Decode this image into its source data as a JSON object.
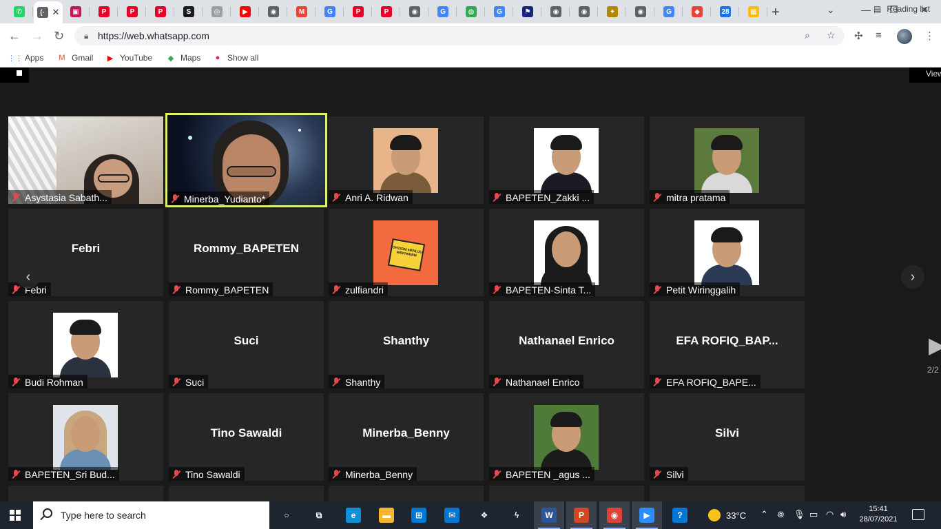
{
  "browser": {
    "tabs": [
      {
        "name": "whatsapp",
        "glyph": "✆",
        "color": "#25d366"
      },
      {
        "name": "active",
        "glyph": "(·",
        "color": "#5f6368"
      },
      {
        "name": "profile",
        "glyph": "▣",
        "color": "#c2185b"
      },
      {
        "name": "pinterest-1",
        "glyph": "P",
        "color": "#e60023"
      },
      {
        "name": "pinterest-2",
        "glyph": "P",
        "color": "#e60023"
      },
      {
        "name": "pinterest-3",
        "glyph": "P",
        "color": "#e60023"
      },
      {
        "name": "scribd",
        "glyph": "S",
        "color": "#1b1b1b"
      },
      {
        "name": "generic-1",
        "glyph": "◎",
        "color": "#9aa0a6"
      },
      {
        "name": "youtube",
        "glyph": "▶",
        "color": "#ff0000"
      },
      {
        "name": "chrome-1",
        "glyph": "◉",
        "color": "#5f6368"
      },
      {
        "name": "gmail",
        "glyph": "M",
        "color": "#ea4335"
      },
      {
        "name": "google-1",
        "glyph": "G",
        "color": "#4285f4"
      },
      {
        "name": "pinterest-4",
        "glyph": "P",
        "color": "#e60023"
      },
      {
        "name": "pinterest-5",
        "glyph": "P",
        "color": "#e60023"
      },
      {
        "name": "chrome-2",
        "glyph": "◉",
        "color": "#5f6368"
      },
      {
        "name": "google-2",
        "glyph": "G",
        "color": "#4285f4"
      },
      {
        "name": "lens",
        "glyph": "◍",
        "color": "#34a853"
      },
      {
        "name": "google-3",
        "glyph": "G",
        "color": "#4285f4"
      },
      {
        "name": "flag",
        "glyph": "⚑",
        "color": "#1a237e"
      },
      {
        "name": "globe-1",
        "glyph": "◉",
        "color": "#5f6368"
      },
      {
        "name": "chrome-3",
        "glyph": "◉",
        "color": "#5f6368"
      },
      {
        "name": "emblem",
        "glyph": "✦",
        "color": "#b28704"
      },
      {
        "name": "globe-2",
        "glyph": "◉",
        "color": "#5f6368"
      },
      {
        "name": "google-4",
        "glyph": "G",
        "color": "#4285f4"
      },
      {
        "name": "maps",
        "glyph": "◆",
        "color": "#ea4335"
      },
      {
        "name": "calendar",
        "glyph": "28",
        "color": "#1a73e8"
      },
      {
        "name": "tiles",
        "glyph": "▦",
        "color": "#fbbc04"
      }
    ],
    "url": "https://web.whatsapp.com",
    "bookmarks": [
      {
        "label": "Apps",
        "glyph": "⋮⋮",
        "color": "#4285f4"
      },
      {
        "label": "Gmail",
        "glyph": "M",
        "color": "#ea4335"
      },
      {
        "label": "YouTube",
        "glyph": "▶",
        "color": "#ff0000"
      },
      {
        "label": "Maps",
        "glyph": "◆",
        "color": "#34a853"
      },
      {
        "label": "Show all",
        "glyph": "●",
        "color": "#e91e63"
      }
    ],
    "reading_list": "Reading list"
  },
  "zoom": {
    "view_label": "View",
    "page_indicator": "2/2",
    "participants": [
      {
        "name": "Asystasia Sabath...",
        "kind": "video-room",
        "active": false
      },
      {
        "name": "Minerba_Yudianto",
        "kind": "video-space",
        "active": true
      },
      {
        "name": "Anri A. Ridwan",
        "kind": "photo",
        "bg": "#e8b58a",
        "shirt": "#7a5b3a",
        "active": false
      },
      {
        "name": "BAPETEN_Zakki ...",
        "kind": "photo",
        "bg": "#ffffff",
        "shirt": "#1b1b24",
        "active": false
      },
      {
        "name": "mitra pratama",
        "kind": "photo",
        "bg": "#5c7a3d",
        "shirt": "#d9d9d9",
        "active": false
      },
      {
        "name": "Febri",
        "big": "Febri",
        "kind": "name",
        "active": false
      },
      {
        "name": "Rommy_BAPETEN",
        "big": "Rommy_BAPETEN",
        "kind": "name",
        "active": false
      },
      {
        "name": "zulfiandri",
        "kind": "poster",
        "poster_text": "OP2SDM MENUJU WBK/WBBM",
        "active": false
      },
      {
        "name": "BAPETEN-Sinta T...",
        "kind": "photo-hijab",
        "bg": "#ffffff",
        "shirt": "#1b1b1b",
        "active": false
      },
      {
        "name": "Petit Wiringgalih",
        "kind": "photo",
        "bg": "#ffffff",
        "shirt": "#2b3a55",
        "active": false
      },
      {
        "name": "Budi Rohman",
        "kind": "photo",
        "bg": "#ffffff",
        "shirt": "#2c3140",
        "active": false
      },
      {
        "name": "Suci",
        "big": "Suci",
        "kind": "name",
        "active": false
      },
      {
        "name": "Shanthy",
        "big": "Shanthy",
        "kind": "name",
        "active": false
      },
      {
        "name": "Nathanael Enrico",
        "big": "Nathanael Enrico",
        "kind": "name",
        "active": false
      },
      {
        "name": "EFA ROFIQ_BAPE...",
        "big": "EFA  ROFIQ_BAP...",
        "kind": "name",
        "active": false
      },
      {
        "name": "BAPETEN_Sri Bud...",
        "kind": "photo-hijab",
        "bg": "#dfe4ea",
        "shirt": "#6b8fb3",
        "active": false
      },
      {
        "name": "Tino Sawaldi",
        "big": "Tino Sawaldi",
        "kind": "name",
        "active": false
      },
      {
        "name": "Minerba_Benny",
        "big": "Minerba_Benny",
        "kind": "name",
        "active": false
      },
      {
        "name": "BAPETEN _agus ...",
        "kind": "photo",
        "bg": "#4f7a3a",
        "shirt": "#1c1c1c",
        "active": false
      },
      {
        "name": "Silvi",
        "big": "Silvi",
        "kind": "name",
        "active": false
      }
    ]
  },
  "taskbar": {
    "search_placeholder": "Type here to search",
    "apps": [
      {
        "name": "cortana",
        "glyph": "○",
        "color": "#1f2530",
        "open": false
      },
      {
        "name": "task-view",
        "glyph": "⧉",
        "color": "#1f2530",
        "open": false
      },
      {
        "name": "edge",
        "glyph": "e",
        "color": "#0f8fd6",
        "open": false
      },
      {
        "name": "file-explorer",
        "glyph": "▬",
        "color": "#f3b52f",
        "open": false
      },
      {
        "name": "store",
        "glyph": "⊞",
        "color": "#0078d4",
        "open": false
      },
      {
        "name": "mail",
        "glyph": "✉",
        "color": "#0078d4",
        "open": false
      },
      {
        "name": "dropbox",
        "glyph": "❖",
        "color": "#1f2530",
        "open": false
      },
      {
        "name": "bolt",
        "glyph": "ϟ",
        "color": "#1f2530",
        "open": false
      },
      {
        "name": "word",
        "glyph": "W",
        "color": "#2b579a",
        "open": true
      },
      {
        "name": "powerpoint",
        "glyph": "P",
        "color": "#d24726",
        "open": true
      },
      {
        "name": "chrome",
        "glyph": "◉",
        "color": "#db4437",
        "open": true
      },
      {
        "name": "zoom",
        "glyph": "▶",
        "color": "#2d8cff",
        "open": true
      },
      {
        "name": "help",
        "glyph": "?",
        "color": "#0078d4",
        "open": false
      }
    ],
    "weather": "33°C",
    "time": "15:41",
    "date": "28/07/2021"
  }
}
